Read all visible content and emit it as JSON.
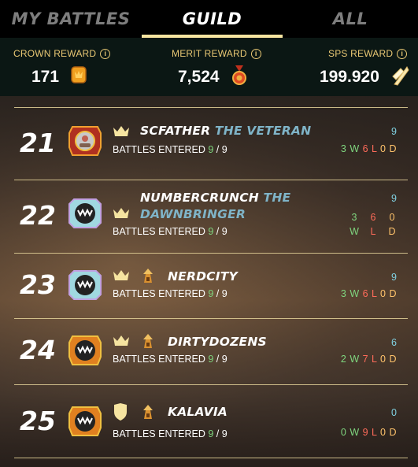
{
  "tabs": [
    {
      "label": "MY BATTLES",
      "active": false
    },
    {
      "label": "GUILD",
      "active": true
    },
    {
      "label": "ALL",
      "active": false
    }
  ],
  "rewards": {
    "crown": {
      "label": "CROWN REWARD",
      "value": "171",
      "icon": "crown-token-icon"
    },
    "merit": {
      "label": "MERIT REWARD",
      "value": "7,524",
      "icon": "merit-medal-icon"
    },
    "sps": {
      "label": "SPS REWARD",
      "value": "199.920",
      "icon": "sps-token-icon"
    }
  },
  "battles_prefix": "BATTLES ENTERED",
  "rows": [
    {
      "rank": "21",
      "name": "SCFATHER",
      "title": "THE VETERAN",
      "entered": "9",
      "total": "9",
      "count": "9",
      "w": "3",
      "l": "6",
      "d": "0",
      "w_label": "W",
      "l_label": "L",
      "d_label": "D"
    },
    {
      "rank": "22",
      "name": "NUMBERCRUNCH",
      "title": "THE",
      "title2": "DAWNBRINGER",
      "entered": "9",
      "total": "9",
      "count": "9",
      "w": "3",
      "l": "6",
      "d": "0",
      "w_label": "W",
      "l_label": "L",
      "d_label": "D"
    },
    {
      "rank": "23",
      "name": "NERDCITY",
      "entered": "9",
      "total": "9",
      "count": "9",
      "w": "3",
      "l": "6",
      "d": "0",
      "w_label": "W",
      "l_label": "L",
      "d_label": "D"
    },
    {
      "rank": "24",
      "name": "DIRTYDOZENS",
      "entered": "9",
      "total": "9",
      "count": "6",
      "w": "2",
      "l": "7",
      "d": "0",
      "w_label": "W",
      "l_label": "L",
      "d_label": "D"
    },
    {
      "rank": "25",
      "name": "KALAVIA",
      "entered": "9",
      "total": "9",
      "count": "0",
      "w": "0",
      "l": "9",
      "d": "0",
      "w_label": "W",
      "l_label": "L",
      "d_label": "D"
    }
  ],
  "colors": {
    "accent": "#f6e4a0",
    "gold": "#e9c874",
    "win": "#7fd67f",
    "loss": "#ff6b5a",
    "draw": "#ffc36b",
    "title": "#7fb4c8"
  }
}
